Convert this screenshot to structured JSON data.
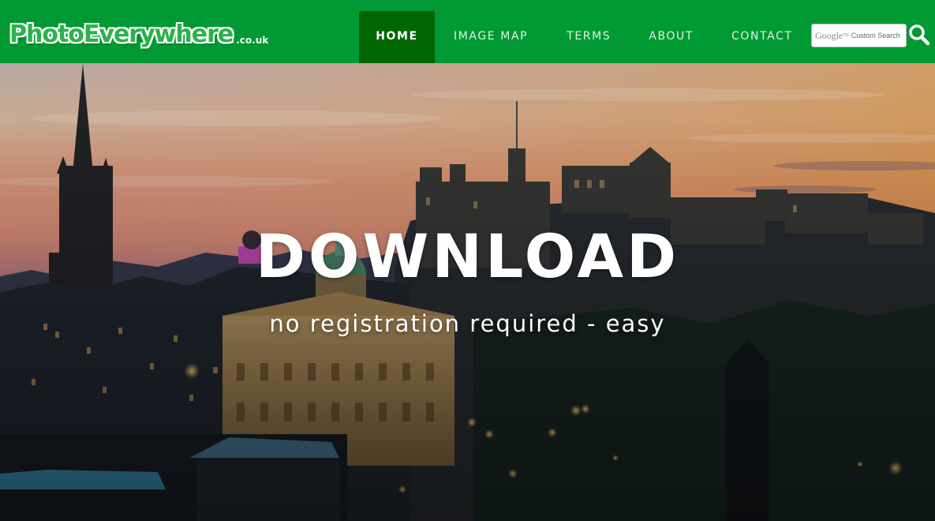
{
  "header": {
    "logo": {
      "main": "PhotoEverywhere",
      "tld": ".co.uk"
    },
    "nav": [
      {
        "label": "HOME",
        "active": true
      },
      {
        "label": "IMAGE MAP",
        "active": false
      },
      {
        "label": "TERMS",
        "active": false
      },
      {
        "label": "ABOUT",
        "active": false
      },
      {
        "label": "CONTACT",
        "active": false
      }
    ],
    "search": {
      "brand": "Google",
      "trademark": "TM",
      "placeholder": "Custom Search",
      "button_icon": "search-icon"
    }
  },
  "hero": {
    "title": "DOWNLOAD",
    "subtitle": "no registration required - easy",
    "scene": "edinburgh-castle-dusk-photo"
  },
  "colors": {
    "header_green": "#009933",
    "active_nav_green": "#006600",
    "text_white": "#ffffff"
  }
}
